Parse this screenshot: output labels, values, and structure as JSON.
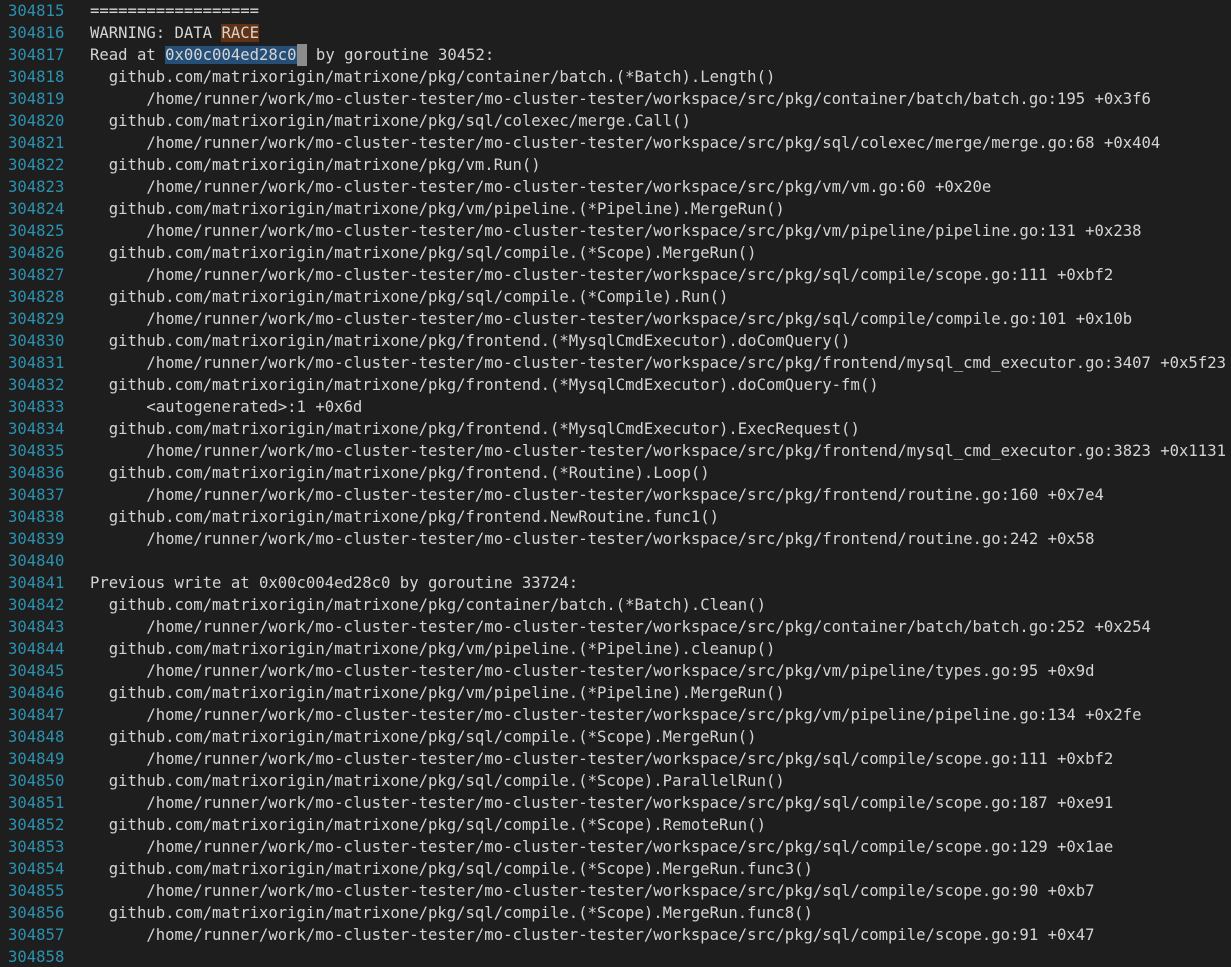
{
  "editor": {
    "colors": {
      "background": "#1e1e1e",
      "line_number": "#2b91af",
      "text": "#d4d4d4",
      "find_highlight": "#613214",
      "selection": "#264f78",
      "cursor": "#8c8c8c"
    },
    "lines": [
      {
        "num": "304815",
        "text": "=================="
      },
      {
        "num": "304816",
        "pre": "WARNING: DATA ",
        "find": "RACE"
      },
      {
        "num": "304817",
        "pre": "Read at ",
        "sel": "0x00c004ed28c0",
        "cursor": true,
        "post": " by goroutine 30452:"
      },
      {
        "num": "304818",
        "text": "  github.com/matrixorigin/matrixone/pkg/container/batch.(*Batch).Length()"
      },
      {
        "num": "304819",
        "text": "      /home/runner/work/mo-cluster-tester/mo-cluster-tester/workspace/src/pkg/container/batch/batch.go:195 +0x3f6"
      },
      {
        "num": "304820",
        "text": "  github.com/matrixorigin/matrixone/pkg/sql/colexec/merge.Call()"
      },
      {
        "num": "304821",
        "text": "      /home/runner/work/mo-cluster-tester/mo-cluster-tester/workspace/src/pkg/sql/colexec/merge/merge.go:68 +0x404"
      },
      {
        "num": "304822",
        "text": "  github.com/matrixorigin/matrixone/pkg/vm.Run()"
      },
      {
        "num": "304823",
        "text": "      /home/runner/work/mo-cluster-tester/mo-cluster-tester/workspace/src/pkg/vm/vm.go:60 +0x20e"
      },
      {
        "num": "304824",
        "text": "  github.com/matrixorigin/matrixone/pkg/vm/pipeline.(*Pipeline).MergeRun()"
      },
      {
        "num": "304825",
        "text": "      /home/runner/work/mo-cluster-tester/mo-cluster-tester/workspace/src/pkg/vm/pipeline/pipeline.go:131 +0x238"
      },
      {
        "num": "304826",
        "text": "  github.com/matrixorigin/matrixone/pkg/sql/compile.(*Scope).MergeRun()"
      },
      {
        "num": "304827",
        "text": "      /home/runner/work/mo-cluster-tester/mo-cluster-tester/workspace/src/pkg/sql/compile/scope.go:111 +0xbf2"
      },
      {
        "num": "304828",
        "text": "  github.com/matrixorigin/matrixone/pkg/sql/compile.(*Compile).Run()"
      },
      {
        "num": "304829",
        "text": "      /home/runner/work/mo-cluster-tester/mo-cluster-tester/workspace/src/pkg/sql/compile/compile.go:101 +0x10b"
      },
      {
        "num": "304830",
        "text": "  github.com/matrixorigin/matrixone/pkg/frontend.(*MysqlCmdExecutor).doComQuery()"
      },
      {
        "num": "304831",
        "text": "      /home/runner/work/mo-cluster-tester/mo-cluster-tester/workspace/src/pkg/frontend/mysql_cmd_executor.go:3407 +0x5f23"
      },
      {
        "num": "304832",
        "text": "  github.com/matrixorigin/matrixone/pkg/frontend.(*MysqlCmdExecutor).doComQuery-fm()"
      },
      {
        "num": "304833",
        "text": "      <autogenerated>:1 +0x6d"
      },
      {
        "num": "304834",
        "text": "  github.com/matrixorigin/matrixone/pkg/frontend.(*MysqlCmdExecutor).ExecRequest()"
      },
      {
        "num": "304835",
        "text": "      /home/runner/work/mo-cluster-tester/mo-cluster-tester/workspace/src/pkg/frontend/mysql_cmd_executor.go:3823 +0x1131"
      },
      {
        "num": "304836",
        "text": "  github.com/matrixorigin/matrixone/pkg/frontend.(*Routine).Loop()"
      },
      {
        "num": "304837",
        "text": "      /home/runner/work/mo-cluster-tester/mo-cluster-tester/workspace/src/pkg/frontend/routine.go:160 +0x7e4"
      },
      {
        "num": "304838",
        "text": "  github.com/matrixorigin/matrixone/pkg/frontend.NewRoutine.func1()"
      },
      {
        "num": "304839",
        "text": "      /home/runner/work/mo-cluster-tester/mo-cluster-tester/workspace/src/pkg/frontend/routine.go:242 +0x58"
      },
      {
        "num": "304840",
        "text": ""
      },
      {
        "num": "304841",
        "text": "Previous write at 0x00c004ed28c0 by goroutine 33724:"
      },
      {
        "num": "304842",
        "text": "  github.com/matrixorigin/matrixone/pkg/container/batch.(*Batch).Clean()"
      },
      {
        "num": "304843",
        "text": "      /home/runner/work/mo-cluster-tester/mo-cluster-tester/workspace/src/pkg/container/batch/batch.go:252 +0x254"
      },
      {
        "num": "304844",
        "text": "  github.com/matrixorigin/matrixone/pkg/vm/pipeline.(*Pipeline).cleanup()"
      },
      {
        "num": "304845",
        "text": "      /home/runner/work/mo-cluster-tester/mo-cluster-tester/workspace/src/pkg/vm/pipeline/types.go:95 +0x9d"
      },
      {
        "num": "304846",
        "text": "  github.com/matrixorigin/matrixone/pkg/vm/pipeline.(*Pipeline).MergeRun()"
      },
      {
        "num": "304847",
        "text": "      /home/runner/work/mo-cluster-tester/mo-cluster-tester/workspace/src/pkg/vm/pipeline/pipeline.go:134 +0x2fe"
      },
      {
        "num": "304848",
        "text": "  github.com/matrixorigin/matrixone/pkg/sql/compile.(*Scope).MergeRun()"
      },
      {
        "num": "304849",
        "text": "      /home/runner/work/mo-cluster-tester/mo-cluster-tester/workspace/src/pkg/sql/compile/scope.go:111 +0xbf2"
      },
      {
        "num": "304850",
        "text": "  github.com/matrixorigin/matrixone/pkg/sql/compile.(*Scope).ParallelRun()"
      },
      {
        "num": "304851",
        "text": "      /home/runner/work/mo-cluster-tester/mo-cluster-tester/workspace/src/pkg/sql/compile/scope.go:187 +0xe91"
      },
      {
        "num": "304852",
        "text": "  github.com/matrixorigin/matrixone/pkg/sql/compile.(*Scope).RemoteRun()"
      },
      {
        "num": "304853",
        "text": "      /home/runner/work/mo-cluster-tester/mo-cluster-tester/workspace/src/pkg/sql/compile/scope.go:129 +0x1ae"
      },
      {
        "num": "304854",
        "text": "  github.com/matrixorigin/matrixone/pkg/sql/compile.(*Scope).MergeRun.func3()"
      },
      {
        "num": "304855",
        "text": "      /home/runner/work/mo-cluster-tester/mo-cluster-tester/workspace/src/pkg/sql/compile/scope.go:90 +0xb7"
      },
      {
        "num": "304856",
        "text": "  github.com/matrixorigin/matrixone/pkg/sql/compile.(*Scope).MergeRun.func8()"
      },
      {
        "num": "304857",
        "text": "      /home/runner/work/mo-cluster-tester/mo-cluster-tester/workspace/src/pkg/sql/compile/scope.go:91 +0x47"
      },
      {
        "num": "304858",
        "text": ""
      }
    ]
  }
}
